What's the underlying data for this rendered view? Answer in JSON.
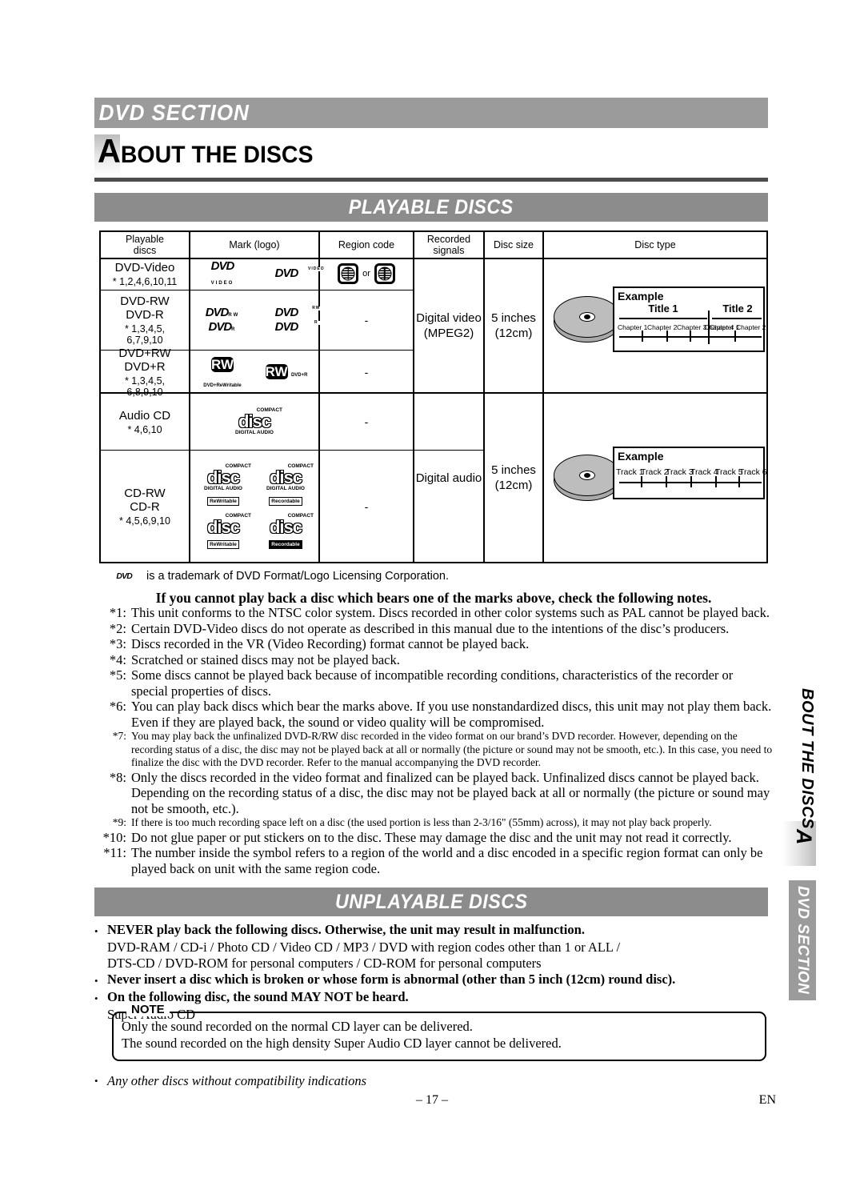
{
  "header": {
    "section_bar": "DVD SECTION",
    "page_title_cap": "A",
    "page_title_rest": "BOUT THE DISCS"
  },
  "bands": {
    "playable": "PLAYABLE DISCS",
    "unplayable": "UNPLAYABLE DISCS"
  },
  "table": {
    "columns": [
      "Playable discs",
      "Mark (logo)",
      "Region code",
      "Recorded signals",
      "Disc size",
      "Disc type"
    ],
    "columns_lines": {
      "c0_l1": "Playable",
      "c0_l2": "discs",
      "c1": "Mark (logo)",
      "c2": "Region code",
      "c3_l1": "Recorded",
      "c3_l2": "signals",
      "c4": "Disc size",
      "c5": "Disc type"
    },
    "rows": [
      {
        "name_lines": [
          "DVD-Video"
        ],
        "stars": "* 1,2,4,6,10,11",
        "marks": [
          "DVD VIDEO",
          "DVD VIDEO"
        ],
        "region_code": "globe or globe",
        "region_or": "or"
      },
      {
        "name_lines": [
          "DVD-RW",
          "DVD-R"
        ],
        "stars_l1": "* 1,3,4,5,",
        "stars_l2": "6,7,9,10",
        "marks": [
          "DVD RW",
          "DVD RW",
          "DVD R",
          "DVD R"
        ],
        "region_code": "-"
      },
      {
        "name_lines": [
          "DVD+RW",
          "DVD+R"
        ],
        "stars_l1": "* 1,3,4,5,",
        "stars_l2": "6,8,9,10",
        "marks": [
          "DVD+ReWritable",
          "DVD+R"
        ],
        "region_code": "-"
      },
      {
        "name_lines": [
          "Audio CD"
        ],
        "stars": "* 4,6,10",
        "marks": [
          "COMPACT disc DIGITAL AUDIO"
        ],
        "region_code": "-"
      },
      {
        "name_lines": [
          "CD-RW",
          "CD-R"
        ],
        "stars": "* 4,5,6,9,10",
        "marks": [
          "COMPACT disc DIGITAL AUDIO ReWritable",
          "COMPACT disc DIGITAL AUDIO Recordable",
          "COMPACT disc ReWritable",
          "COMPACT disc Recordable"
        ],
        "region_code": "-"
      }
    ],
    "rw_caption_1": "DVD+ReWritable",
    "rw_caption_2": "DVD+R",
    "cd_compact": "COMPACT",
    "cd_word": "disc",
    "cd_digital_audio": "DIGITAL AUDIO",
    "cd_rewritable": "ReWritable",
    "cd_recordable": "Recordable",
    "video_group": {
      "recorded_signals_l1": "Digital video",
      "recorded_signals_l2": "(MPEG2)",
      "disc_size_l1": "5 inches",
      "disc_size_l2": "(12cm)",
      "example_label": "Example",
      "titles": [
        "Title 1",
        "Title 2"
      ],
      "chapters": [
        "Chapter 1",
        "Chapter 2",
        "Chapter 3",
        "Chapter 4",
        "Chapter 1",
        "Chapter 2"
      ]
    },
    "audio_group": {
      "recorded_signals": "Digital audio",
      "disc_size_l1": "5 inches",
      "disc_size_l2": "(12cm)",
      "example_label": "Example",
      "tracks": [
        "Track 1",
        "Track 2",
        "Track 3",
        "Track 4",
        "Track 5",
        "Track 6"
      ]
    }
  },
  "trademark_note": "is a trademark of DVD Format/Logo Licensing Corporation.",
  "notes_heading": "If you cannot play back a disc which bears one of the marks above, check the following notes.",
  "notes": [
    {
      "num": "*1:",
      "text": "This unit conforms to the NTSC color system. Discs recorded in other color systems such as PAL cannot be played back."
    },
    {
      "num": "*2:",
      "text": "Certain DVD-Video discs do not operate as described in this manual due to the intentions of the disc’s producers."
    },
    {
      "num": "*3:",
      "text": "Discs recorded in the VR (Video Recording) format cannot be played back."
    },
    {
      "num": "*4:",
      "text": "Scratched or stained discs may not be played back."
    },
    {
      "num": "*5:",
      "text": "Some discs cannot be played back because of incompatible recording conditions, characteristics of the recorder or special properties of discs."
    },
    {
      "num": "*6:",
      "text": "You can play back discs which bear the marks above. If you use nonstandardized discs, this unit may not play them back. Even if they are played back, the sound or video quality will be compromised."
    },
    {
      "num": "*7:",
      "text": "You may play back the unfinalized DVD-R/RW disc recorded in the video format on our brand’s DVD recorder. However, depending on the recording status of a disc, the disc may not be played back at all or normally (the picture or sound may not be smooth, etc.). In this case, you need to finalize the disc with the DVD recorder. Refer to the manual accompanying the DVD recorder."
    },
    {
      "num": "*8:",
      "text": "Only the discs recorded in the video format and finalized can be played back. Unfinalized discs cannot be played back. Depending on the recording status of a disc, the disc may not be played back at all or normally (the picture or sound may not be smooth, etc.)."
    },
    {
      "num": "*9:",
      "text": "If there is too much recording space left on a disc (the used portion is less than 2-3/16\" (55mm) across), it may not play back properly."
    },
    {
      "num": "*10:",
      "text": "Do not glue paper or put stickers on to the disc. These may damage the disc and the unit may not read it correctly."
    },
    {
      "num": "*11:",
      "text": "The number inside the symbol refers to a region of the world and a disc encoded in a specific region format can only be played back on unit with the same region code."
    }
  ],
  "unplayable": {
    "bullet1_bold": "NEVER play back the following discs. Otherwise, the unit may result in malfunction.",
    "bullet1_line1": "DVD-RAM / CD-i / Photo CD / Video CD / MP3 / DVD with region codes other than 1 or ALL /",
    "bullet1_line2": "DTS-CD / DVD-ROM for personal computers / CD-ROM for personal computers",
    "bullet2_bold": "Never insert a disc which is broken or whose form is abnormal (other than 5 inch (12cm) round disc).",
    "bullet3_bold": "On the following disc, the sound MAY NOT be heard.",
    "bullet3_plain": "Super Audio CD",
    "note_label": "NOTE",
    "note_line1": "Only the sound recorded on the normal CD layer can be delivered.",
    "note_line2": "The sound recorded on the high density Super Audio CD layer cannot be delivered.",
    "last_bullet": "Any other discs without compatibility indications"
  },
  "footer": {
    "page_number": "– 17 –",
    "lang": "EN"
  },
  "side_tabs": {
    "about_cap": "A",
    "about_rest": "BOUT THE DISCS",
    "dvd_section": "DVD SECTION"
  },
  "colors": {
    "band_gray": "#8c8c8c",
    "section_gray": "#9b9b9b",
    "rule_dark": "#4d4d4d",
    "disc_gray": "#a8a8a8"
  }
}
